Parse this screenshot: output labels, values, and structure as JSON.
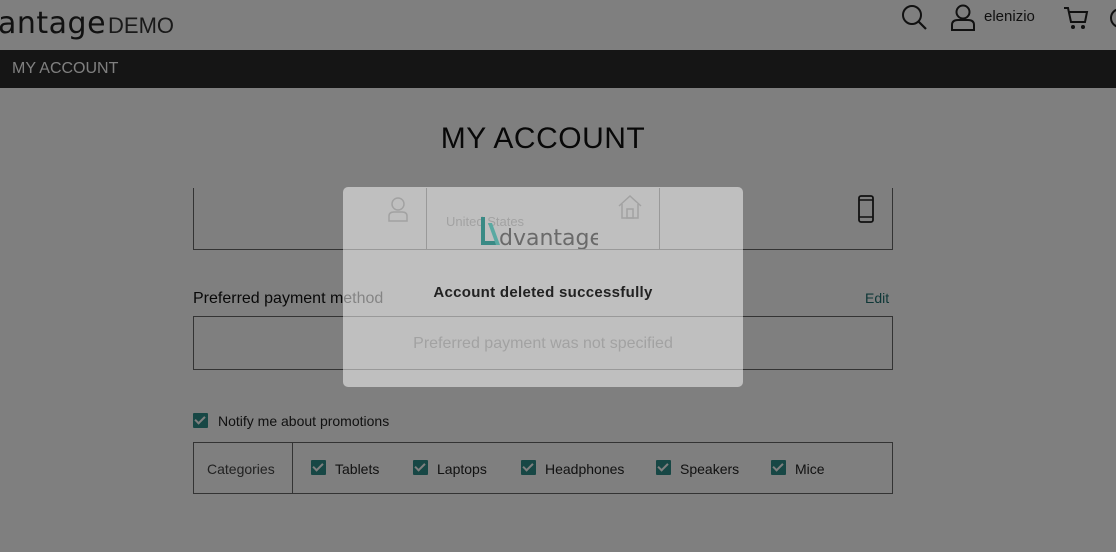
{
  "header": {
    "logo_main": "antage",
    "logo_sub": "DEMO",
    "username": "elenizio",
    "icons": [
      "search-icon",
      "user-icon",
      "cart-icon",
      "help-icon"
    ]
  },
  "nav": {
    "title": "MY ACCOUNT"
  },
  "page": {
    "title": "MY ACCOUNT"
  },
  "address": {
    "country": "United States",
    "icons": [
      "user-icon",
      "home-icon",
      "phone-icon"
    ]
  },
  "payment": {
    "label": "Preferred payment method",
    "edit_label": "Edit",
    "empty_text": "Preferred payment was not specified"
  },
  "promotions": {
    "notify_label": "Notify me about promotions",
    "notify_checked": true
  },
  "categories": {
    "title": "Categories",
    "items": [
      {
        "label": "Tablets",
        "checked": true
      },
      {
        "label": "Laptops",
        "checked": true
      },
      {
        "label": "Headphones",
        "checked": true
      },
      {
        "label": "Speakers",
        "checked": true
      },
      {
        "label": "Mice",
        "checked": true
      }
    ]
  },
  "modal": {
    "logo_text": "dvantage",
    "message": "Account deleted successfully"
  },
  "colors": {
    "accent": "#2f8f8a",
    "edit_link": "#1d6f6f",
    "navbar": "#2b2b2b",
    "overlay": "rgba(0,0,0,0.5)"
  }
}
